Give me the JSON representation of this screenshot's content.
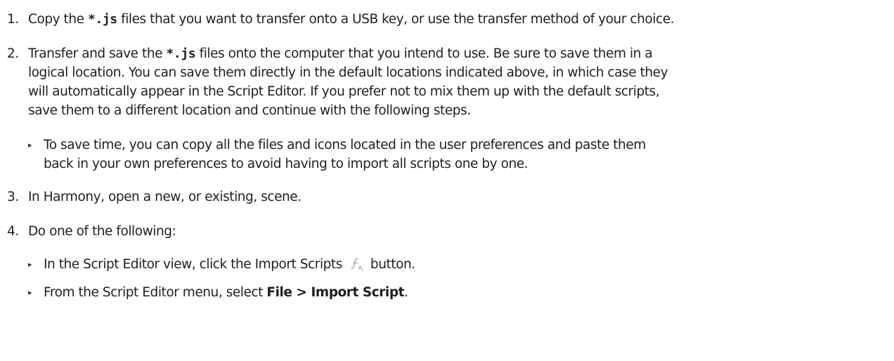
{
  "steps": [
    {
      "number": "1.",
      "parts": [
        "Copy the ",
        "*.js",
        " files that you want to transfer onto a USB key, or use the transfer method of your choice."
      ]
    },
    {
      "number": "2.",
      "line1": [
        "Transfer and save the ",
        "*.js",
        " files onto the computer that you intend to use. Be sure to save them in a"
      ],
      "line2": "logical location. You can save them directly in the default locations indicated above, in which case they",
      "line3": "will automatically appear in the Script Editor. If you prefer not to mix them up with the default scripts,",
      "line4": "save them to a different location and continue with the following steps.",
      "bullet": {
        "line1": "To save time, you can copy all the files and icons located in the user preferences and paste them",
        "line2": "back in your own preferences to avoid having to import all scripts one by one."
      }
    },
    {
      "number": "3.",
      "text": "In Harmony, open a new, or existing, scene."
    },
    {
      "number": "4.",
      "text": "Do one of the following:",
      "bullets": [
        {
          "before": "In the Script Editor view, click the Import Scripts",
          "after": "button.",
          "icon": "import-scripts-icon"
        },
        {
          "before": "From the Script Editor menu, select ",
          "bold": "File > Import Script",
          "after": "."
        }
      ]
    }
  ],
  "bullet_glyph": "▸"
}
